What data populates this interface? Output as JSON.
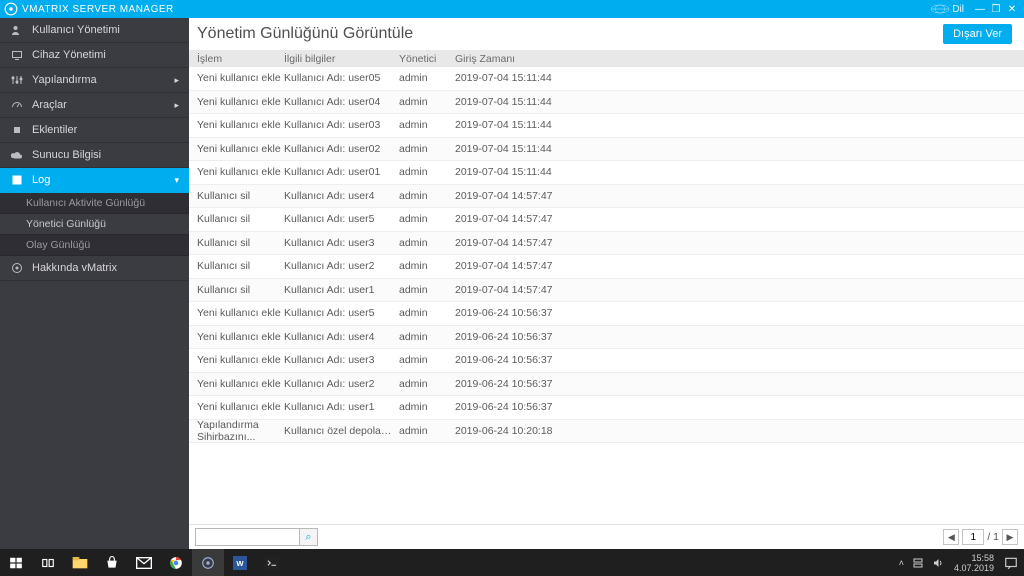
{
  "titlebar": {
    "app_name": "VMATRIX SERVER MANAGER",
    "lang_label": "Dil"
  },
  "sidebar": {
    "items": [
      {
        "label": "Kullanıcı Yönetimi",
        "chev": false
      },
      {
        "label": "Cihaz Yönetimi",
        "chev": false
      },
      {
        "label": "Yapılandırma",
        "chev": true
      },
      {
        "label": "Araçlar",
        "chev": true
      },
      {
        "label": "Eklentiler",
        "chev": false
      },
      {
        "label": "Sunucu Bilgisi",
        "chev": false
      },
      {
        "label": "Log",
        "chev": true,
        "active": true
      }
    ],
    "subitems": [
      {
        "label": "Kullanıcı Aktivite Günlüğü"
      },
      {
        "label": "Yönetici Günlüğü",
        "selected": true
      },
      {
        "label": "Olay Günlüğü"
      }
    ],
    "about": {
      "label": "Hakkında vMatrix"
    }
  },
  "content": {
    "title": "Yönetim Günlüğünü Görüntüle",
    "export_label": "Dışarı Ver",
    "columns": {
      "a": "İşlem",
      "b": "İlgili bilgiler",
      "c": "Yönetici",
      "d": "Giriş Zamanı"
    },
    "rows": [
      {
        "a": "Yeni kullanıcı ekle",
        "b": "Kullanıcı Adı: user05",
        "c": "admin",
        "d": "2019-07-04 15:11:44"
      },
      {
        "a": "Yeni kullanıcı ekle",
        "b": "Kullanıcı Adı: user04",
        "c": "admin",
        "d": "2019-07-04 15:11:44"
      },
      {
        "a": "Yeni kullanıcı ekle",
        "b": "Kullanıcı Adı: user03",
        "c": "admin",
        "d": "2019-07-04 15:11:44"
      },
      {
        "a": "Yeni kullanıcı ekle",
        "b": "Kullanıcı Adı: user02",
        "c": "admin",
        "d": "2019-07-04 15:11:44"
      },
      {
        "a": "Yeni kullanıcı ekle",
        "b": "Kullanıcı Adı: user01",
        "c": "admin",
        "d": "2019-07-04 15:11:44"
      },
      {
        "a": "Kullanıcı sil",
        "b": "Kullanıcı Adı: user4",
        "c": "admin",
        "d": "2019-07-04 14:57:47"
      },
      {
        "a": "Kullanıcı sil",
        "b": "Kullanıcı Adı: user5",
        "c": "admin",
        "d": "2019-07-04 14:57:47"
      },
      {
        "a": "Kullanıcı sil",
        "b": "Kullanıcı Adı: user3",
        "c": "admin",
        "d": "2019-07-04 14:57:47"
      },
      {
        "a": "Kullanıcı sil",
        "b": "Kullanıcı Adı: user2",
        "c": "admin",
        "d": "2019-07-04 14:57:47"
      },
      {
        "a": "Kullanıcı sil",
        "b": "Kullanıcı Adı: user1",
        "c": "admin",
        "d": "2019-07-04 14:57:47"
      },
      {
        "a": "Yeni kullanıcı ekle",
        "b": "Kullanıcı Adı: user5",
        "c": "admin",
        "d": "2019-06-24 10:56:37"
      },
      {
        "a": "Yeni kullanıcı ekle",
        "b": "Kullanıcı Adı: user4",
        "c": "admin",
        "d": "2019-06-24 10:56:37"
      },
      {
        "a": "Yeni kullanıcı ekle",
        "b": "Kullanıcı Adı: user3",
        "c": "admin",
        "d": "2019-06-24 10:56:37"
      },
      {
        "a": "Yeni kullanıcı ekle",
        "b": "Kullanıcı Adı: user2",
        "c": "admin",
        "d": "2019-06-24 10:56:37"
      },
      {
        "a": "Yeni kullanıcı ekle",
        "b": "Kullanıcı Adı: user1",
        "c": "admin",
        "d": "2019-06-24 10:56:37"
      },
      {
        "a": "Yapılandırma Sihirbazını...",
        "b": "Kullanıcı özel depolama alanı:...",
        "c": "admin",
        "d": "2019-06-24 10:20:18"
      }
    ],
    "search": {
      "placeholder": "",
      "value": ""
    },
    "pager": {
      "page": "1",
      "total": "/ 1"
    }
  },
  "taskbar": {
    "clock": {
      "time": "15:58",
      "date": "4.07.2019"
    }
  }
}
